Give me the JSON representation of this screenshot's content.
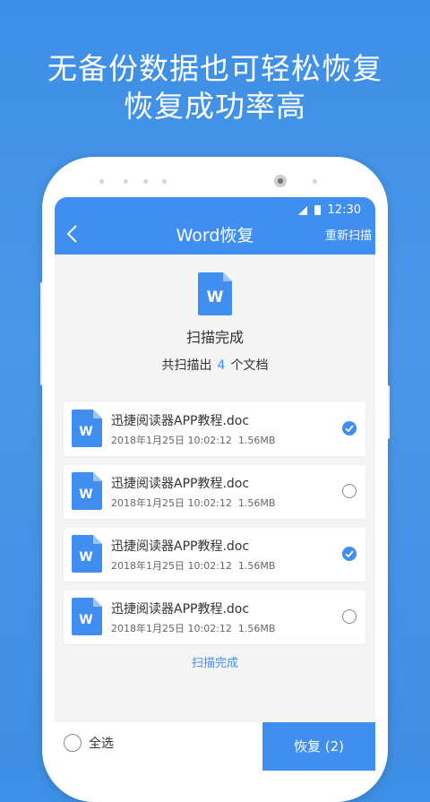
{
  "headline": {
    "line1": "无备份数据也可轻松恢复",
    "line2": "恢复成功率高"
  },
  "status_bar": {
    "time": "12:30"
  },
  "app_bar": {
    "title": "Word恢复",
    "action_label": "重新扫描"
  },
  "scan_summary": {
    "file_icon_letter": "W",
    "status": "扫描完成",
    "count_prefix": "共扫描出",
    "count": "4",
    "count_suffix": "个文档"
  },
  "files": [
    {
      "icon_letter": "W",
      "name": "迅捷阅读器APP教程.doc",
      "date": "2018年1月25日 10:02:12",
      "size": "1.56MB",
      "checked": true
    },
    {
      "icon_letter": "W",
      "name": "迅捷阅读器APP教程.doc",
      "date": "2018年1月25日 10:02:12",
      "size": "1.56MB",
      "checked": false
    },
    {
      "icon_letter": "W",
      "name": "迅捷阅读器APP教程.doc",
      "date": "2018年1月25日 10:02:12",
      "size": "1.56MB",
      "checked": true
    },
    {
      "icon_letter": "W",
      "name": "迅捷阅读器APP教程.doc",
      "date": "2018年1月25日 10:02:12",
      "size": "1.56MB",
      "checked": false
    }
  ],
  "list_footer": "扫描完成",
  "bottom_bar": {
    "select_all_label": "全选",
    "restore_label": "恢复 (2)"
  },
  "colors": {
    "accent": "#3f8ef0",
    "background": "#4a97e8"
  }
}
